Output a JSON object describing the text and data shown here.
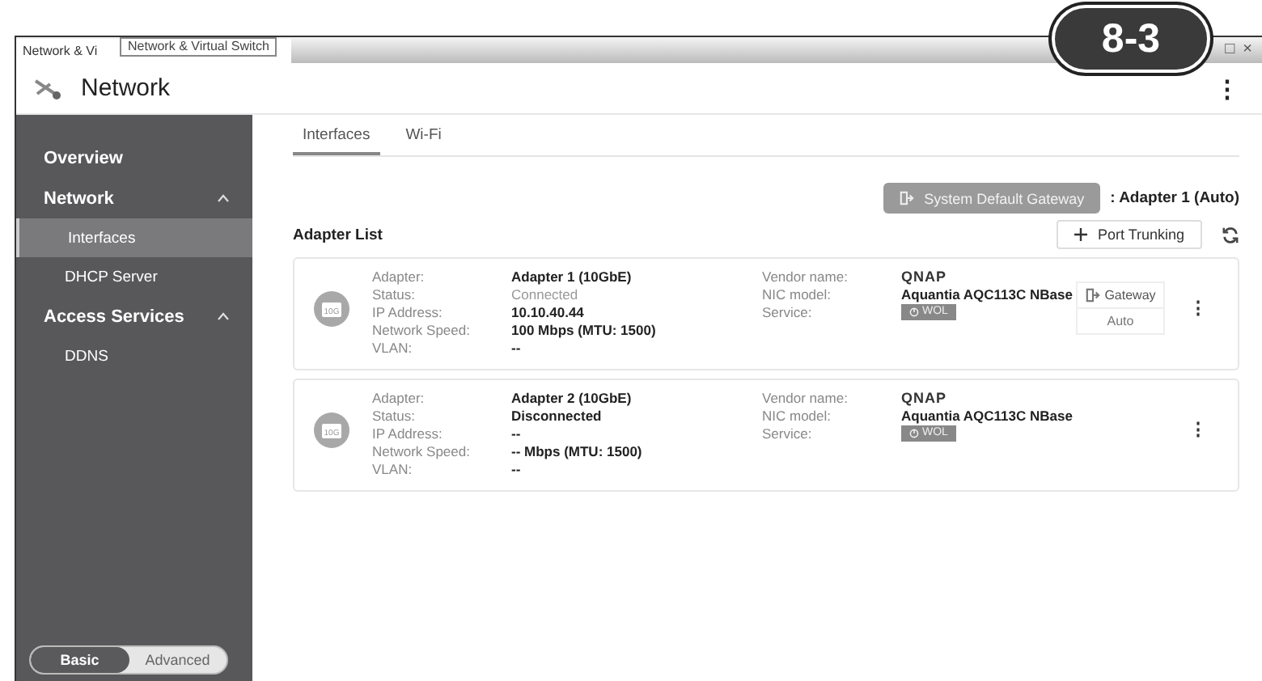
{
  "window": {
    "title": "Network & Vi",
    "tooltip": "Network & Virtual Switch",
    "controls": [
      "□",
      "×"
    ]
  },
  "callout": "8-3",
  "header": {
    "title": "Network",
    "menu": "⋮"
  },
  "sidebar": {
    "items": [
      {
        "label": "Overview",
        "kind": "group",
        "selected": false
      },
      {
        "label": "Network",
        "kind": "group",
        "selected": false,
        "expanded": true,
        "children": [
          {
            "label": "Interfaces",
            "kind": "sub",
            "selected": true
          },
          {
            "label": "DHCP Server",
            "kind": "sub",
            "selected": false
          }
        ]
      },
      {
        "label": "Access Services",
        "kind": "group",
        "selected": false,
        "expanded": true,
        "children": [
          {
            "label": "DDNS",
            "kind": "sub",
            "selected": false
          }
        ]
      }
    ],
    "modes": [
      {
        "label": "Basic",
        "selected": true
      },
      {
        "label": "Advanced",
        "selected": false
      }
    ]
  },
  "tabs": [
    {
      "label": "Interfaces",
      "selected": true
    },
    {
      "label": "Wi-Fi",
      "selected": false
    }
  ],
  "gateway": {
    "button": "System Default Gateway",
    "value": ": Adapter 1 (Auto)"
  },
  "adapter_list": {
    "title": "Adapter List",
    "port_trunking": "Port Trunking",
    "adapters": [
      {
        "badge": "10G",
        "connected": true,
        "fields": [
          {
            "label": "Adapter:",
            "value": "Adapter 1 (10GbE)"
          },
          {
            "label": "Status:",
            "value": "Connected"
          },
          {
            "label": "IP Address:",
            "value": "10.10.40.44"
          },
          {
            "label": "Network Speed:",
            "value": "100 Mbps (MTU: 1500)"
          },
          {
            "label": "VLAN:",
            "value": "--"
          }
        ],
        "vendor_label": "Vendor name:",
        "vendor": "QNAP",
        "nic_label": "NIC model:",
        "nic": "Aquantia AQC113C NBase",
        "service_label": "Service:",
        "service": "WOL",
        "gateway": {
          "label": "Gateway",
          "mode": "Auto"
        }
      },
      {
        "badge": "10G",
        "connected": false,
        "fields": [
          {
            "label": "Adapter:",
            "value": "Adapter 2 (10GbE)"
          },
          {
            "label": "Status:",
            "value": "Disconnected"
          },
          {
            "label": "IP Address:",
            "value": "--"
          },
          {
            "label": "Network Speed:",
            "value": "-- Mbps (MTU: 1500)"
          },
          {
            "label": "VLAN:",
            "value": "--"
          }
        ],
        "vendor_label": "Vendor name:",
        "vendor": "QNAP",
        "nic_label": "NIC model:",
        "nic": "Aquantia AQC113C NBase",
        "service_label": "Service:",
        "service": "WOL"
      }
    ]
  }
}
